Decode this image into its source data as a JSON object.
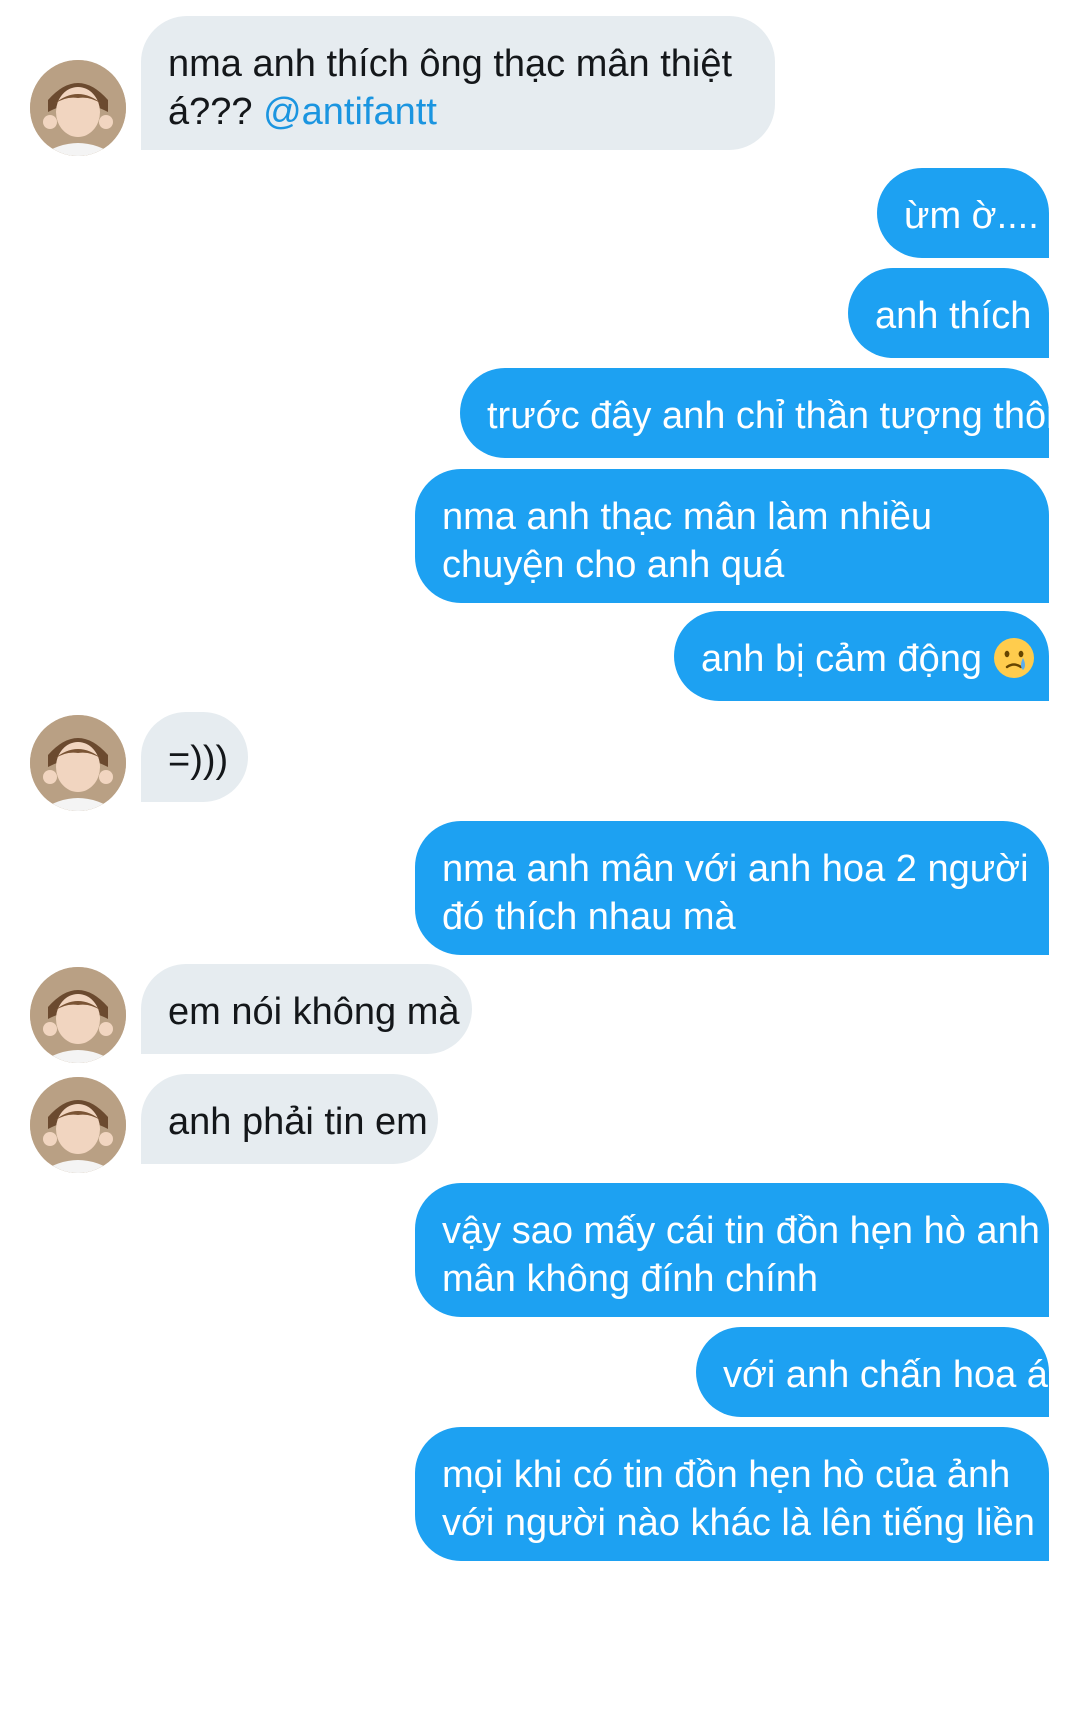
{
  "messages": [
    {
      "side": "in",
      "lines": [
        "nma anh thích ông thạc mân thiệt"
      ],
      "line2_prefix": "á??? ",
      "mention": "@antifantt"
    },
    {
      "side": "out",
      "text": "ừm ờ...."
    },
    {
      "side": "out",
      "text": "anh thích"
    },
    {
      "side": "out",
      "text": "trước đây anh chỉ thần tượng thôi"
    },
    {
      "side": "out",
      "lines": [
        "nma anh thạc mân làm nhiều",
        "chuyện cho anh quá"
      ]
    },
    {
      "side": "out",
      "text": "anh bị cảm động",
      "emoji": "crying-face-emoji"
    },
    {
      "side": "in",
      "text": "=)))"
    },
    {
      "side": "out",
      "lines": [
        "nma anh mân với anh hoa 2 người",
        "đó thích nhau mà"
      ]
    },
    {
      "side": "in",
      "text": "em nói không mà"
    },
    {
      "side": "in",
      "text": "anh phải tin em"
    },
    {
      "side": "out",
      "lines": [
        "vậy sao mấy cái tin đồn hẹn hò anh",
        "mân không đính chính"
      ]
    },
    {
      "side": "out",
      "text": "với anh chấn hoa á"
    },
    {
      "side": "out",
      "lines": [
        "mọi khi có tin đồn hẹn hò của ảnh",
        "với người nào khác là lên tiếng liền"
      ]
    }
  ],
  "colors": {
    "incoming_bubble": "#e6ecf0",
    "outgoing_bubble": "#1da1f2",
    "mention": "#1b95e0",
    "incoming_text": "#14171a",
    "outgoing_text": "#ffffff"
  }
}
